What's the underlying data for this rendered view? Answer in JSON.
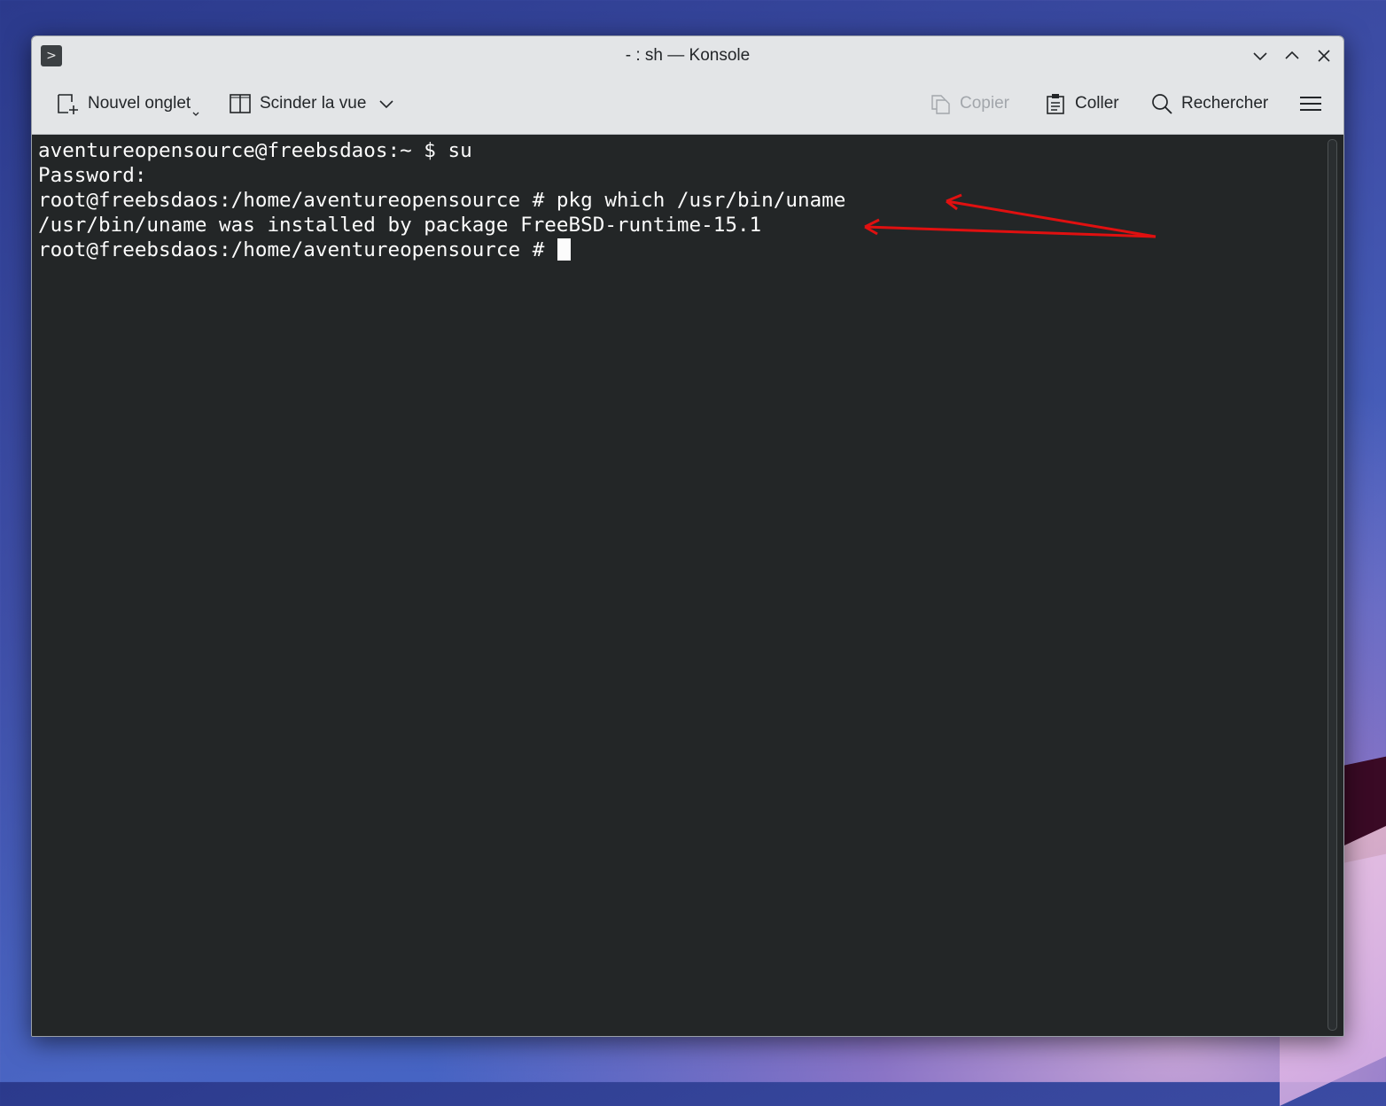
{
  "window": {
    "title": "- : sh — Konsole",
    "app_icon_glyph": ">"
  },
  "toolbar": {
    "new_tab_label": "Nouvel onglet",
    "split_view_label": "Scinder la vue",
    "copy_label": "Copier",
    "paste_label": "Coller",
    "search_label": "Rechercher"
  },
  "terminal": {
    "lines": [
      "aventureopensource@freebsdaos:~ $ su",
      "Password:",
      "root@freebsdaos:/home/aventureopensource # pkg which /usr/bin/uname",
      "/usr/bin/uname was installed by package FreeBSD-runtime-15.1",
      "root@freebsdaos:/home/aventureopensource # "
    ]
  },
  "colors": {
    "terminal_bg": "#232627",
    "terminal_fg": "#fcfcfc",
    "chrome_bg": "#e3e5e7",
    "annotation_arrow": "#e01010"
  }
}
